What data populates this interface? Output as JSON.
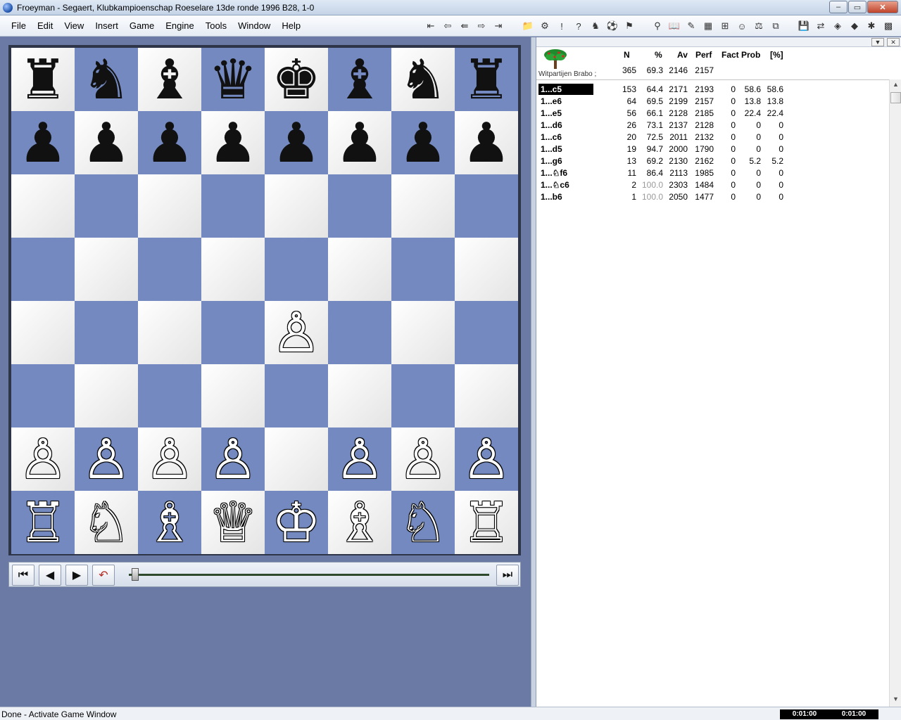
{
  "window": {
    "title": "Froeyman - Segaert, Klubkampioenschap Roeselare 13de ronde 1996  B28, 1-0",
    "minimize": "–",
    "maximize": "▭",
    "close": "✕"
  },
  "menu": [
    "File",
    "Edit",
    "View",
    "Insert",
    "Game",
    "Engine",
    "Tools",
    "Window",
    "Help"
  ],
  "toolbar": {
    "nav_icons": [
      "⇤",
      "⇦",
      "⇚",
      "⇨",
      "⇥"
    ],
    "tool_icons": [
      "📁",
      "⚙",
      "!",
      "?",
      "♞",
      "⚽",
      "⚑"
    ],
    "view_icons": [
      "⚲",
      "📖",
      "✎",
      "▦",
      "⊞",
      "☺",
      "⚖",
      "⧉"
    ],
    "right_icons": [
      "💾",
      "⇄",
      "◈",
      "◆",
      "✱",
      "▩"
    ]
  },
  "board": {
    "rows": [
      [
        "♜",
        "♞",
        "♝",
        "♛",
        "♚",
        "♝",
        "♞",
        "♜"
      ],
      [
        "♟",
        "♟",
        "♟",
        "♟",
        "♟",
        "♟",
        "♟",
        "♟"
      ],
      [
        "",
        "",
        "",
        "",
        "",
        "",
        "",
        ""
      ],
      [
        "",
        "",
        "",
        "",
        "",
        "",
        "",
        ""
      ],
      [
        "",
        "",
        "",
        "",
        "♙",
        "",
        "",
        ""
      ],
      [
        "",
        "",
        "",
        "",
        "",
        "",
        "",
        ""
      ],
      [
        "♙",
        "♙",
        "♙",
        "♙",
        "",
        "♙",
        "♙",
        "♙"
      ],
      [
        "♖",
        "♘",
        "♗",
        "♕",
        "♔",
        "♗",
        "♘",
        "♖"
      ]
    ],
    "colors": {
      "light": "#f4f4f4",
      "dark": "#7389bf"
    }
  },
  "nav": {
    "first": "⏮",
    "prev": "◀",
    "next": "▶",
    "undo": "↶",
    "last": "⏭",
    "position": 0.0
  },
  "book": {
    "name": "Witpartijen Brabo ;",
    "headers": {
      "n": "N",
      "pct": "%",
      "av": "Av",
      "perf": "Perf",
      "fact": "Fact",
      "prob": "Prob",
      "probpct": "[%]"
    },
    "summary": {
      "n": "365",
      "pct": "69.3",
      "av": "2146",
      "perf": "2157"
    },
    "moves": [
      {
        "move": "1...c5",
        "n": "153",
        "pct": "64.4",
        "av": "2171",
        "perf": "2193",
        "fact": "0",
        "prob": "58.6",
        "probpct": "58.6",
        "selected": true
      },
      {
        "move": "1...e6",
        "n": "64",
        "pct": "69.5",
        "av": "2199",
        "perf": "2157",
        "fact": "0",
        "prob": "13.8",
        "probpct": "13.8"
      },
      {
        "move": "1...e5",
        "n": "56",
        "pct": "66.1",
        "av": "2128",
        "perf": "2185",
        "fact": "0",
        "prob": "22.4",
        "probpct": "22.4"
      },
      {
        "move": "1...d6",
        "n": "26",
        "pct": "73.1",
        "av": "2137",
        "perf": "2128",
        "fact": "0",
        "prob": "0",
        "probpct": "0"
      },
      {
        "move": "1...c6",
        "n": "20",
        "pct": "72.5",
        "av": "2011",
        "perf": "2132",
        "fact": "0",
        "prob": "0",
        "probpct": "0"
      },
      {
        "move": "1...d5",
        "n": "19",
        "pct": "94.7",
        "av": "2000",
        "perf": "1790",
        "fact": "0",
        "prob": "0",
        "probpct": "0"
      },
      {
        "move": "1...g6",
        "n": "13",
        "pct": "69.2",
        "av": "2130",
        "perf": "2162",
        "fact": "0",
        "prob": "5.2",
        "probpct": "5.2"
      },
      {
        "move": "1...♘f6",
        "n": "11",
        "pct": "86.4",
        "av": "2113",
        "perf": "1985",
        "fact": "0",
        "prob": "0",
        "probpct": "0"
      },
      {
        "move": "1...♘c6",
        "n": "2",
        "pct": "100.0",
        "av": "2303",
        "perf": "1484",
        "fact": "0",
        "prob": "0",
        "probpct": "0",
        "grey": true
      },
      {
        "move": "1...b6",
        "n": "1",
        "pct": "100.0",
        "av": "2050",
        "perf": "1477",
        "fact": "0",
        "prob": "0",
        "probpct": "0",
        "grey": true
      }
    ]
  },
  "status": {
    "text": "Done - Activate Game Window",
    "clock_white": "0:01:00",
    "clock_black": "0:01:00"
  }
}
